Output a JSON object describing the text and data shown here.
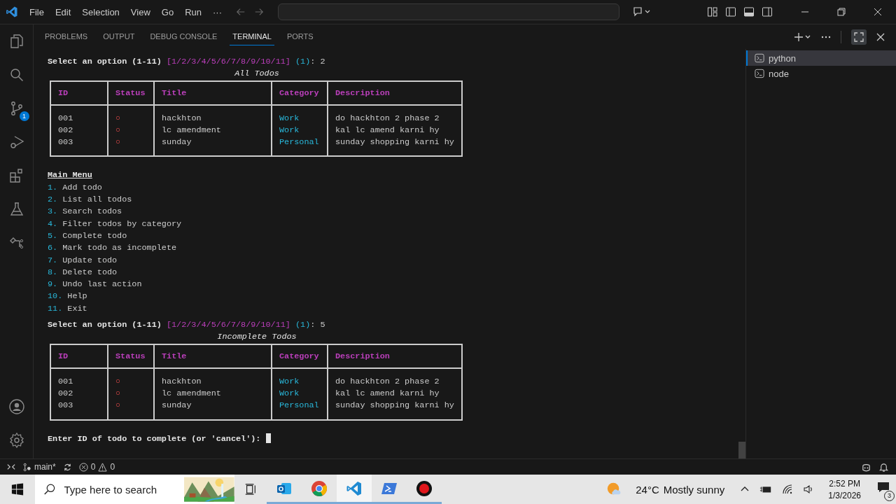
{
  "menu": [
    "File",
    "Edit",
    "Selection",
    "View",
    "Go",
    "Run",
    "···"
  ],
  "panel_tabs": [
    {
      "label": "PROBLEMS",
      "selected": false
    },
    {
      "label": "OUTPUT",
      "selected": false
    },
    {
      "label": "DEBUG CONSOLE",
      "selected": false
    },
    {
      "label": "TERMINAL",
      "selected": true
    },
    {
      "label": "PORTS",
      "selected": false
    }
  ],
  "activity_badge": "1",
  "terminal": [
    {
      "kind": "prompt",
      "text": "Select an option (1-11)",
      "choices": "[1/2/3/4/5/6/7/8/9/10/11]",
      "default": "(1)",
      "suffix": ": 2"
    },
    {
      "kind": "table",
      "title": "All Todos",
      "columns": [
        "ID",
        "Status",
        "Title",
        "Category",
        "Description"
      ],
      "rows": [
        {
          "id": "001",
          "status": "○",
          "title": "hackhton",
          "category": "Work",
          "description": "do hackhton 2 phase 2"
        },
        {
          "id": "002",
          "status": "○",
          "title": "lc amendment",
          "category": "Work",
          "description": "kal lc amend karni hy"
        },
        {
          "id": "003",
          "status": "○",
          "title": "sunday",
          "category": "Personal",
          "description": "sunday shopping karni hy"
        }
      ]
    },
    {
      "kind": "heading",
      "text": "Main Menu"
    },
    {
      "kind": "menu_item",
      "number": "1.",
      "label": "Add todo"
    },
    {
      "kind": "menu_item",
      "number": "2.",
      "label": "List all todos"
    },
    {
      "kind": "menu_item",
      "number": "3.",
      "label": "Search todos"
    },
    {
      "kind": "menu_item",
      "number": "4.",
      "label": "Filter todos by category"
    },
    {
      "kind": "menu_item",
      "number": "5.",
      "label": "Complete todo"
    },
    {
      "kind": "menu_item",
      "number": "6.",
      "label": "Mark todo as incomplete"
    },
    {
      "kind": "menu_item",
      "number": "7.",
      "label": "Update todo"
    },
    {
      "kind": "menu_item",
      "number": "8.",
      "label": "Delete todo"
    },
    {
      "kind": "menu_item",
      "number": "9.",
      "label": "Undo last action"
    },
    {
      "kind": "menu_item",
      "number": "10.",
      "label": "Help"
    },
    {
      "kind": "menu_item",
      "number": "11.",
      "label": "Exit"
    },
    {
      "kind": "prompt",
      "text": "Select an option (1-11)",
      "choices": "[1/2/3/4/5/6/7/8/9/10/11]",
      "default": "(1)",
      "suffix": ": 5"
    },
    {
      "kind": "table",
      "title": "Incomplete Todos",
      "columns": [
        "ID",
        "Status",
        "Title",
        "Category",
        "Description"
      ],
      "rows": [
        {
          "id": "001",
          "status": "○",
          "title": "hackhton",
          "category": "Work",
          "description": "do hackhton 2 phase 2"
        },
        {
          "id": "002",
          "status": "○",
          "title": "lc amendment",
          "category": "Work",
          "description": "kal lc amend karni hy"
        },
        {
          "id": "003",
          "status": "○",
          "title": "sunday",
          "category": "Personal",
          "description": "sunday shopping karni hy"
        }
      ]
    },
    {
      "kind": "input",
      "text": "Enter ID of todo to complete (or 'cancel'):"
    }
  ],
  "terminals": [
    {
      "label": "python",
      "selected": true
    },
    {
      "label": "node",
      "selected": false
    }
  ],
  "status_bar": {
    "branch": "main*",
    "errors": "0",
    "warnings": "0"
  },
  "taskbar": {
    "search_placeholder": "Type here to search",
    "temperature": "24°C",
    "weather": "Mostly sunny",
    "time": "2:52 PM",
    "date": "1/3/2026",
    "notifications": "3"
  }
}
